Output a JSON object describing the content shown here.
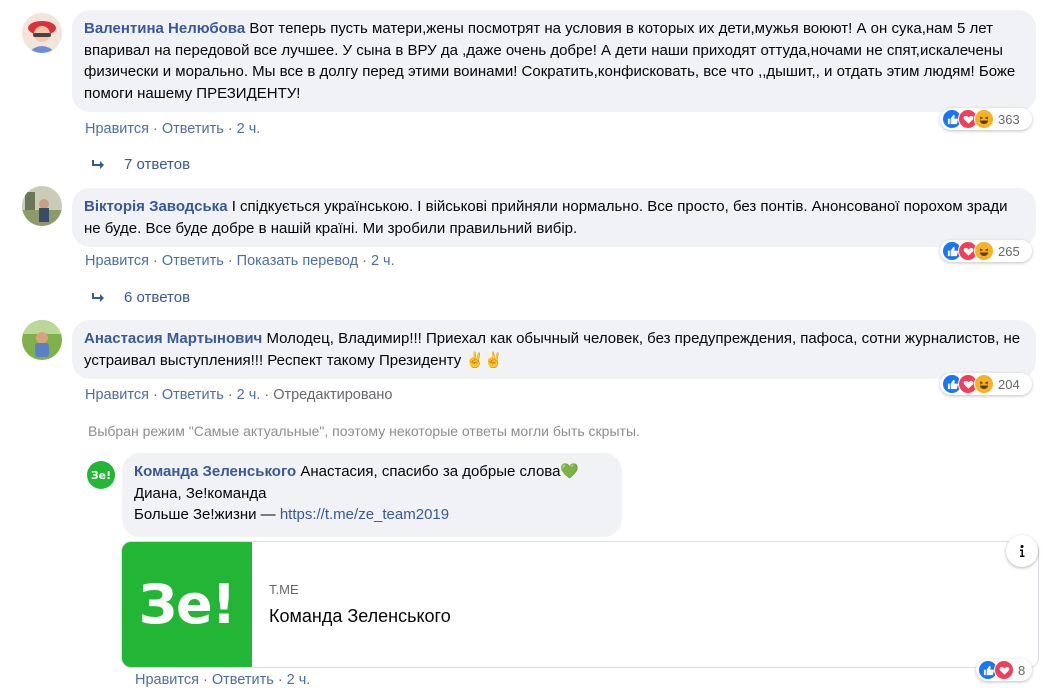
{
  "comments": [
    {
      "author": "Валентина Нелюбова",
      "text": "Вот теперь пусть матери,жены посмотрят на условия в которых их дети,мужья воюют! А он сука,нам 5 лет впаривал на передовой все лучшее. У сына в ВРУ да ,даже очень добре! А дети наши приходят оттуда,ночами не спят,искалечены физически и морально. Мы все в долгу перед этими воинами! Сократить,конфисковать, все что ,,дышит,, и отдать этим людям! Боже помоги нашему ПРЕЗИДЕНТУ!",
      "like": "Нравится",
      "reply": "Ответить",
      "time": "2 ч.",
      "reactions_count": "363",
      "replies_label": "7 ответов"
    },
    {
      "author": "Вікторія Заводська",
      "text": "І спідкується українською. І військові прийняли нормально. Все просто, без понтів. Анонсованої порохом зради не буде. Все буде добре в нашій країні. Ми зробили правильний вибір.",
      "like": "Нравится",
      "reply": "Ответить",
      "translate": "Показать перевод",
      "time": "2 ч.",
      "reactions_count": "265",
      "replies_label": "6 ответов"
    },
    {
      "author": "Анастасия Мартынович",
      "text": "Молодец, Владимир!!! Приехал как обычный человек, без предупреждения, пафоса, сотни журналистов, не устраивал выступления!!! Респект такому Президенту ✌️✌️",
      "like": "Нравится",
      "reply": "Ответить",
      "time": "2 ч.",
      "edited": "Отредактировано",
      "reactions_count": "204"
    }
  ],
  "notice": "Выбран режим \"Самые актуальные\", поэтому некоторые ответы могли быть скрыты.",
  "reply": {
    "author": "Команда Зеленського",
    "avatar_text": "Зе!",
    "line1": "Анастасия, спасибо за добрые слова💚",
    "line2": "Диана, Зе!команда",
    "line3_prefix": "Больше Зе!жизни — ",
    "link": "https://t.me/ze_team2019",
    "card": {
      "logo": "Зе!",
      "domain": "T.ME",
      "title": "Команда Зеленського"
    },
    "like": "Нравится",
    "reply": "Ответить",
    "time": "2 ч.",
    "reactions_count": "8"
  },
  "colors": {
    "link_blue": "#385898",
    "bubble_bg": "#f0f2f5",
    "ze_green": "#22b536",
    "meta_gray": "#65676b"
  },
  "icons": [
    "like-icon",
    "love-icon",
    "haha-icon",
    "reply-arrow-icon",
    "info-icon"
  ]
}
